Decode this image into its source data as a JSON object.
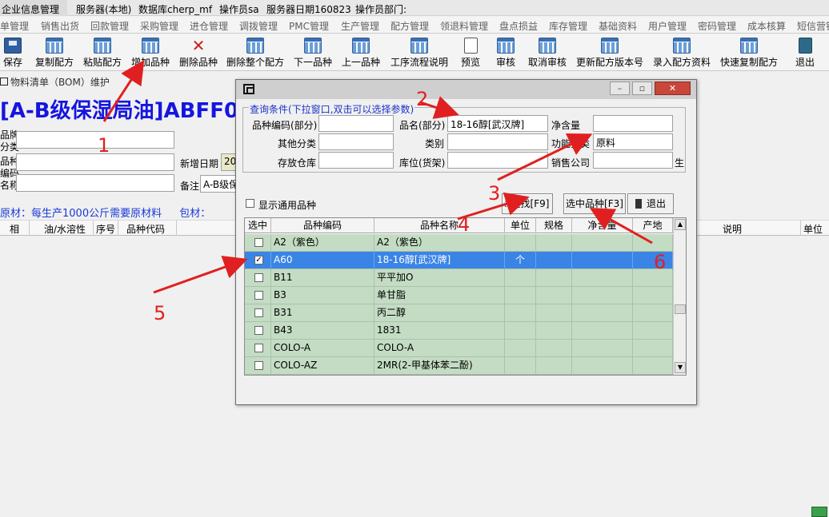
{
  "statusbar": {
    "items": [
      "企业信息管理",
      "服务器(本地)",
      "数据库cherp_mf",
      "操作员sa",
      "服务器日期160823",
      "操作员部门:"
    ]
  },
  "menubar": {
    "items": [
      "单管理",
      "销售出货",
      "回款管理",
      "采购管理",
      "进仓管理",
      "调拨管理",
      "PMC管理",
      "生产管理",
      "配方管理",
      "领退料管理",
      "盘点损益",
      "库存管理",
      "基础资料",
      "用户管理",
      "密码管理",
      "成本核算",
      "短信营销"
    ]
  },
  "toolbar": {
    "buttons": [
      {
        "label": "保存",
        "icon": "save-icon"
      },
      {
        "label": "复制配方",
        "icon": "grid-icon"
      },
      {
        "label": "粘贴配方",
        "icon": "grid-icon"
      },
      {
        "label": "增加品种",
        "icon": "grid-icon"
      },
      {
        "label": "删除品种",
        "icon": "x-icon"
      },
      {
        "label": "删除整个配方",
        "icon": "grid-icon"
      },
      {
        "label": "下一品种",
        "icon": "grid-icon"
      },
      {
        "label": "上一品种",
        "icon": "grid-icon"
      },
      {
        "label": "工序流程说明",
        "icon": "grid-icon"
      },
      {
        "label": "预览",
        "icon": "preview-icon"
      },
      {
        "label": "审核",
        "icon": "grid-icon"
      },
      {
        "label": "取消审核",
        "icon": "grid-icon"
      },
      {
        "label": "更新配方版本号",
        "icon": "grid-icon"
      },
      {
        "label": "录入配方资料",
        "icon": "grid-icon"
      },
      {
        "label": "快速复制配方",
        "icon": "grid-icon"
      },
      {
        "label": "退出",
        "icon": "exit-icon"
      }
    ]
  },
  "subwindow": {
    "title": "物料清单（BOM）维护",
    "product_title": "[A-B级保湿局油]ABFF0",
    "labels": {
      "brand": "品牌",
      "category": "分类",
      "variety": "品种",
      "code": "编码",
      "name": "名称",
      "add_date": "新增日期",
      "remark": "备注"
    },
    "values": {
      "add_date": "20",
      "remark": "A-B级保"
    },
    "info_text": "原材：每生产1000公斤需要原材料",
    "info_text2": "包材："
  },
  "bggrid": {
    "headers_left": [
      "相",
      "油/水溶性",
      "序号",
      "品种代码"
    ],
    "headers_right": [
      "说明",
      "单位"
    ]
  },
  "dialog": {
    "query_legend": "查询条件(下拉窗口,双击可以选择参数)",
    "fields": {
      "code_label": "品种编码(部分)",
      "name_label": "品名(部分)",
      "name_value": "18-16醇[武汉牌]",
      "net_label": "净含量",
      "other_cat_label": "其他分类",
      "class_label": "类别",
      "func_cat_label": "功能分类",
      "func_cat_value": "原料",
      "warehouse_label": "存放仓库",
      "location_label": "库位(货架)",
      "sales_co_label": "销售公司",
      "trailing_char": "生"
    },
    "show_common_label": "显示通用品种",
    "buttons": {
      "search": "查找[F9]",
      "select": "选中品种[F3]",
      "exit": "退出"
    },
    "grid": {
      "headers": [
        "选中",
        "品种编码",
        "品种名称",
        "单位",
        "规格",
        "净含量",
        "产地"
      ],
      "rows": [
        {
          "checked": false,
          "code": "A2（紫色）",
          "name": "A2（紫色）",
          "unit": "",
          "selected": false
        },
        {
          "checked": true,
          "code": "A60",
          "name": "18-16醇[武汉牌]",
          "unit": "个",
          "selected": true
        },
        {
          "checked": false,
          "code": "B11",
          "name": "平平加O",
          "unit": "",
          "selected": false
        },
        {
          "checked": false,
          "code": "B3",
          "name": "单甘脂",
          "unit": "",
          "selected": false
        },
        {
          "checked": false,
          "code": "B31",
          "name": "丙二醇",
          "unit": "",
          "selected": false
        },
        {
          "checked": false,
          "code": "B43",
          "name": "1831",
          "unit": "",
          "selected": false
        },
        {
          "checked": false,
          "code": "COLO-A",
          "name": "COLO-A",
          "unit": "",
          "selected": false
        },
        {
          "checked": false,
          "code": "COLO-AZ",
          "name": "2MR(2-甲基体苯二酚)",
          "unit": "",
          "selected": false
        }
      ]
    }
  },
  "annotations": [
    "1",
    "2",
    "3",
    "4",
    "5",
    "6"
  ],
  "colors": {
    "annotation": "#e02020",
    "row_green": "#c3dcc3",
    "row_selected": "#3a84e6",
    "title_blue": "#1515e0"
  }
}
